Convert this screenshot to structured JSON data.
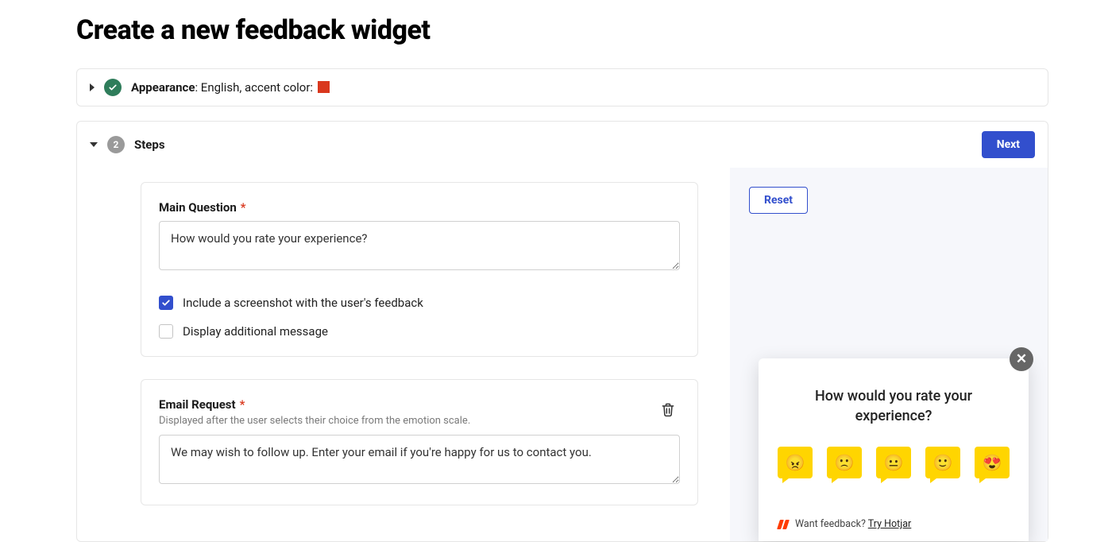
{
  "page_title": "Create a new feedback widget",
  "appearance": {
    "label": "Appearance",
    "summary_prefix": ": English, accent color: ",
    "accent_color": "#d9381e"
  },
  "steps": {
    "badge_number": "2",
    "title": "Steps",
    "next_button": "Next",
    "reset_button": "Reset",
    "main_question": {
      "label": "Main Question",
      "value": "How would you rate your experience?",
      "include_screenshot_label": "Include a screenshot with the user's feedback",
      "include_screenshot_checked": true,
      "display_additional_label": "Display additional message",
      "display_additional_checked": false
    },
    "email_request": {
      "label": "Email Request",
      "help": "Displayed after the user selects their choice from the emotion scale.",
      "value": "We may wish to follow up. Enter your email if you're happy for us to contact you."
    }
  },
  "preview": {
    "question": "How would you rate your experience?",
    "footer_prompt": "Want feedback?",
    "footer_link": "Try Hotjar",
    "emojis": [
      "angry",
      "sad",
      "neutral",
      "happy",
      "love"
    ]
  }
}
